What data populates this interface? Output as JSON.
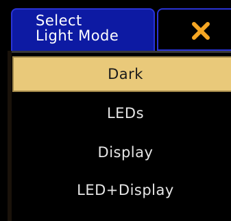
{
  "dialog": {
    "title_line1": "Select",
    "title_line2": "Light Mode",
    "close_icon": "close-icon",
    "accent_color": "#e9c97a",
    "title_bg_color": "#0d1aa3",
    "close_icon_color": "#f5a623"
  },
  "options": [
    {
      "label": "Dark",
      "selected": true
    },
    {
      "label": "LEDs",
      "selected": false
    },
    {
      "label": "Display",
      "selected": false
    },
    {
      "label": "LED+Display",
      "selected": false
    }
  ]
}
